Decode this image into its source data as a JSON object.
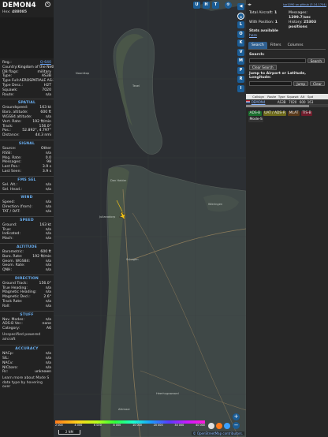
{
  "info": {
    "callsign": "DEMON4",
    "hex_label": "Hex:",
    "hex": "488085",
    "reg_rows": [
      {
        "k": "Reg.:",
        "v": "Q-640",
        "link": true
      },
      {
        "k": "Country:",
        "v": "Kingdom of the Netherlands"
      },
      {
        "k": "DB flags:",
        "v": "military"
      },
      {
        "k": "Type:",
        "v": "AS3B"
      },
      {
        "k": "Type Full:",
        "v": "AEROSPATIALE AS-332 Super Puma Mk2"
      },
      {
        "k": "Type Desc.:",
        "v": "H2T"
      },
      {
        "k": "Squawk:",
        "v": "7020"
      },
      {
        "k": "Route:",
        "v": "n/a"
      }
    ],
    "spatial_title": "SPATIAL",
    "spatial": [
      {
        "k": "Groundspeed:",
        "v": "163 kt"
      },
      {
        "k": "Baro. altitude:",
        "v": "600 ft"
      },
      {
        "k": "WGS84 altitude:",
        "v": "n/a"
      },
      {
        "k": "Vert. Rate:",
        "v": "192 ft/min"
      },
      {
        "k": "Track:",
        "v": "156.0°"
      },
      {
        "k": "Pos.:",
        "v": "52.892°, 4.797°"
      },
      {
        "k": "Distance:",
        "v": "44.3 nmi"
      }
    ],
    "signal_title": "SIGNAL",
    "signal": [
      {
        "k": "Source:",
        "v": "Other"
      },
      {
        "k": "RSSI:",
        "v": "n/a"
      },
      {
        "k": "Msg. Rate:",
        "v": "0.0"
      },
      {
        "k": "Messages:",
        "v": "98"
      },
      {
        "k": "Last Pos.:",
        "v": "3.9 s"
      },
      {
        "k": "Last Seen:",
        "v": "3.9 s"
      }
    ],
    "fms_title": "FMS SEL",
    "fms": [
      {
        "k": "Sel. Alt.:",
        "v": "n/a"
      },
      {
        "k": "Sel. Head.:",
        "v": "n/a"
      }
    ],
    "wind_title": "WIND",
    "wind": [
      {
        "k": "Speed:",
        "v": "n/a"
      },
      {
        "k": "Direction (from):",
        "v": "n/a"
      },
      {
        "k": "TAT / OAT:",
        "v": "n/a"
      }
    ],
    "speed_title": "SPEED",
    "speed": [
      {
        "k": "Ground:",
        "v": "163 kt"
      },
      {
        "k": "True:",
        "v": "n/a"
      },
      {
        "k": "Indicated:",
        "v": "n/a"
      },
      {
        "k": "Mach:",
        "v": "n/a"
      }
    ],
    "altitude_title": "ALTITUDE",
    "altitude": [
      {
        "k": "Barometric:",
        "v": "600 ft"
      },
      {
        "k": "Baro. Rate:",
        "v": "192 ft/min"
      },
      {
        "k": "Geom. WGS84:",
        "v": "n/a"
      },
      {
        "k": "Geom. Rate:",
        "v": "n/a"
      },
      {
        "k": "QNH:",
        "v": "n/a"
      }
    ],
    "direction_title": "DIRECTION",
    "direction": [
      {
        "k": "Ground Track:",
        "v": "156.0°"
      },
      {
        "k": "True Heading:",
        "v": "n/a"
      },
      {
        "k": "Magnetic Heading:",
        "v": "n/a"
      },
      {
        "k": "Magnetic Decl.:",
        "v": "2.6°"
      },
      {
        "k": "Track Rate:",
        "v": "n/a"
      },
      {
        "k": "Roll:",
        "v": "n/a"
      }
    ],
    "stuff_title": "STUFF",
    "stuff": [
      {
        "k": "Nav. Modes:",
        "v": "n/a"
      },
      {
        "k": "ADS-B Ver.:",
        "v": "none"
      },
      {
        "k": "Category:",
        "v": "A6"
      }
    ],
    "stuff_desc": "Unspecified powered aircraft",
    "accuracy_title": "ACCURACY",
    "accuracy": [
      {
        "k": "NACp:",
        "v": "n/a"
      },
      {
        "k": "SIL:",
        "v": "n/a"
      },
      {
        "k": "NACv:",
        "v": "n/a"
      },
      {
        "k": "NICbaro:",
        "v": "n/a"
      },
      {
        "k": "Rc:",
        "v": "unknown"
      }
    ],
    "footer_note": "Learn more about Mode S data type by hovering over"
  },
  "map": {
    "top_buttons": [
      "U",
      "H",
      "T"
    ],
    "places": [
      "Noordkop",
      "Texel",
      "Den Helder",
      "Wieringen",
      "Julianadorp",
      "Schagen",
      "Alkmaar",
      "Heerhugowaard"
    ],
    "attribution": "© OpenStreetMap contributors.",
    "scale_label": "2 NM",
    "zoom_in": "+",
    "zoom_out": "−",
    "altitude_ticks": [
      "2 000",
      "4 000",
      "6 000",
      "8 000",
      "10 000",
      "20 000",
      "30 000",
      "40 000"
    ],
    "colors": {
      "water": "#2c2f33",
      "land": "#3f4847",
      "dunes": "#4a5648",
      "road": "#8a7a5a",
      "aircraft": "#f5c518",
      "button": "#1b5d96"
    }
  },
  "strip": {
    "buttons": [
      "◀",
      "⊙",
      "L",
      "O",
      "K",
      "V",
      "M",
      "P",
      "R",
      "I"
    ]
  },
  "right": {
    "version": "tar1090 on github (3.14.1704)",
    "stats": [
      {
        "label": "Total Aircraft:",
        "value": "1"
      },
      {
        "label": "Messages:",
        "value": "1299.7/sec"
      },
      {
        "label": "With Position:",
        "value": "1"
      },
      {
        "label": "History:",
        "value": "25303 positions"
      }
    ],
    "stats_avail_label": "Stats available",
    "stats_avail_link": "here",
    "tabs": [
      "Search",
      "Filters",
      "Columns"
    ],
    "search_label": "Search:",
    "search_button": "Search",
    "clear_search": "Clear Search",
    "jump_label": "Jump to Airport or Latitude, Longitude:",
    "jump_button": "Jump",
    "clear_button": "Clear",
    "table_headers": [
      "",
      "Callsign",
      "Route",
      "Type",
      "Squawk",
      "Alt",
      "Spd"
    ],
    "table_rows": [
      {
        "callsign": "DEMON4",
        "route": "",
        "type": "AS3B",
        "squawk": "7020",
        "alt": "600",
        "spd": "163"
      }
    ],
    "chips": [
      {
        "text": "ADS-B",
        "bg": "#1b6e2e",
        "fg": "#e8e8e8"
      },
      {
        "text": "UAT / ADS-R",
        "bg": "#6e6a1b",
        "fg": "#e8e8e8"
      },
      {
        "text": "MLAT",
        "bg": "#5a3a1b",
        "fg": "#e8e8e8"
      },
      {
        "text": "TIS-B",
        "bg": "#6e1b2a",
        "fg": "#e8e8e8"
      },
      {
        "text": "Mode-S",
        "bg": "#333333",
        "fg": "#e8e8e8"
      }
    ]
  }
}
